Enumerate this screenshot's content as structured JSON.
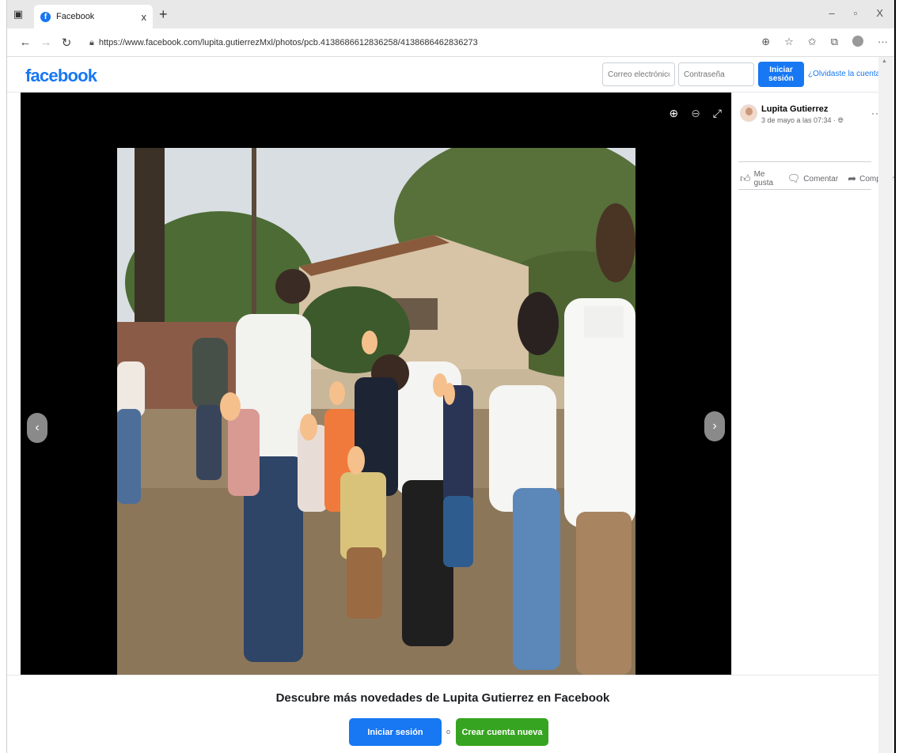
{
  "browser": {
    "tab_title": "Facebook",
    "favicon_letter": "f",
    "new_tab": "+",
    "close_tab": "x",
    "url": "https://www.facebook.com/lupita.gutierrezMxl/photos/pcb.4138686612836258/4138686462836273",
    "window_controls": [
      "–",
      "▫",
      "X"
    ]
  },
  "fb_header": {
    "logo": "facebook",
    "email_placeholder": "Correo electrónico o tel",
    "password_placeholder": "Contraseña",
    "login_label": "Iniciar sesión",
    "forgot_label": "¿Olvidaste la cuenta?"
  },
  "post": {
    "author": "Lupita Gutierrez",
    "time": "3 de mayo a las 07:34 · ",
    "more": "···",
    "actions": {
      "like": "Me gusta",
      "comment": "Comentar",
      "share": "Compartir"
    }
  },
  "bottom": {
    "title": "Descubre más novedades de Lupita Gutierrez en Facebook",
    "login_label": "Iniciar sesión",
    "or": "o",
    "create_label": "Crear cuenta nueva"
  },
  "icons": {
    "sidebar": "sidebar-icon",
    "back": "back-arrow-icon",
    "forward": "forward-arrow-icon",
    "refresh": "refresh-icon",
    "lock": "lock-icon",
    "zoom_in": "zoom-in-icon",
    "zoom_out": "zoom-out-icon",
    "fullscreen": "fullscreen-icon",
    "prev": "chevron-left-icon",
    "next": "chevron-right-icon",
    "globe": "globe-icon"
  },
  "colors": {
    "brand": "#1877f2",
    "create_account": "#36a420",
    "viewer_bg": "#000000"
  }
}
